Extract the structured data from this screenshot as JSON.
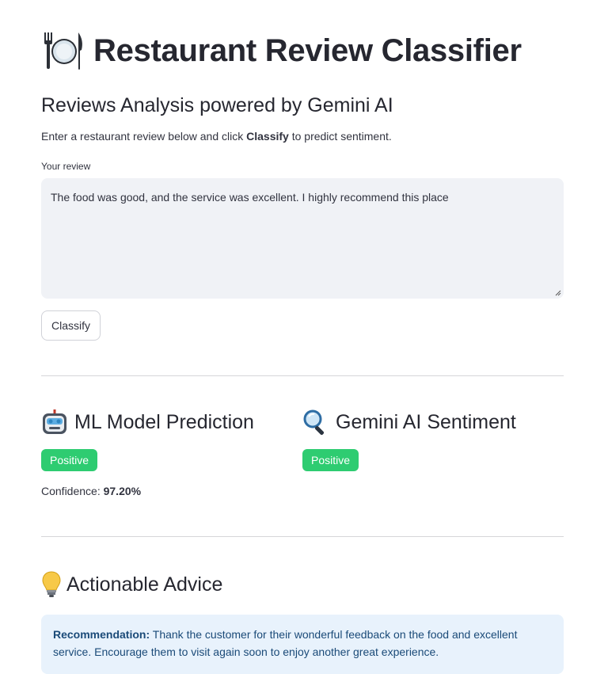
{
  "header": {
    "title": "Restaurant Review Classifier",
    "subtitle": "Reviews Analysis powered by Gemini AI",
    "intro_before": "Enter a restaurant review below and click ",
    "intro_bold": "Classify",
    "intro_after": " to predict sentiment."
  },
  "review": {
    "label": "Your review",
    "value": "The food was good, and the service was excellent. I highly recommend this place"
  },
  "classify_button": "Classify",
  "ml_model": {
    "heading": "ML Model Prediction",
    "badge": "Positive",
    "confidence_label": "Confidence:",
    "confidence_value": "97.20%"
  },
  "gemini": {
    "heading": "Gemini AI Sentiment",
    "badge": "Positive"
  },
  "advice": {
    "heading": "Actionable Advice",
    "rec_label": "Recommendation:",
    "rec_text": "Thank the customer for their wonderful feedback on the food and excellent service. Encourage them to visit again soon to enjoy another great experience."
  },
  "colors": {
    "positive_badge": "#2ecc71",
    "info_bg": "#e8f2fc",
    "info_text": "#1a4a78"
  },
  "icons": {
    "title": "fork-plate-knife-icon",
    "ml": "robot-icon",
    "gemini": "magnifying-glass-icon",
    "advice": "light-bulb-icon"
  }
}
